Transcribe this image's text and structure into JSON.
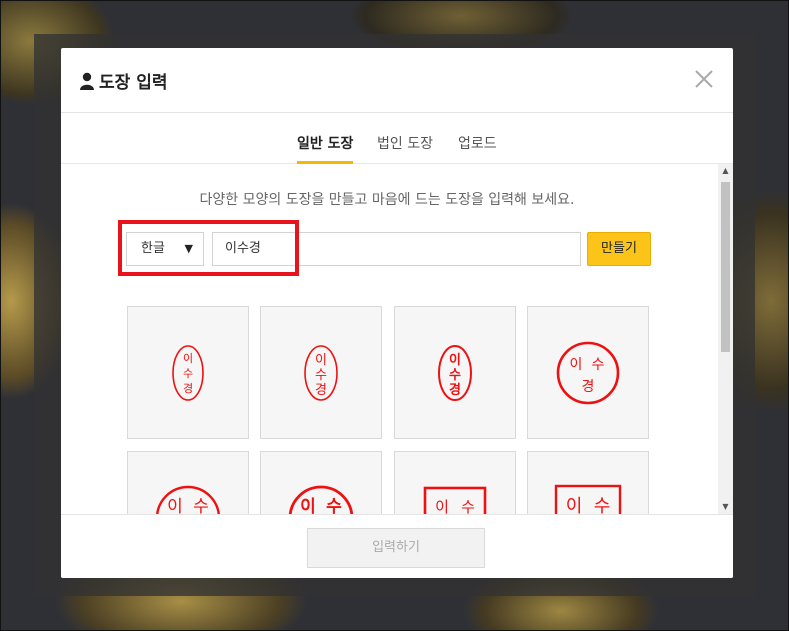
{
  "modal": {
    "title": "도장 입력",
    "close_icon": "close-icon",
    "user_icon": "user-icon"
  },
  "tabs": [
    {
      "label": "일반 도장",
      "active": true
    },
    {
      "label": "법인 도장",
      "active": false
    },
    {
      "label": "업로드",
      "active": false
    }
  ],
  "description": "다양한 모양의 도장을 만들고 마음에 드는 도장을 입력해 보세요.",
  "form": {
    "language_selected": "한글",
    "name_value": "이수경",
    "make_button": "만들기"
  },
  "stamps": {
    "name_chars": [
      "이",
      "수",
      "경"
    ],
    "row1": [
      "oval-seal",
      "oval-plain",
      "oval-bold",
      "circle-seal"
    ],
    "row2": [
      "circle-plain",
      "circle-bold",
      "square-seal",
      "square-plain"
    ]
  },
  "footer": {
    "submit_button": "입력하기"
  },
  "colors": {
    "accent": "#fcc419",
    "stamp_red": "#e11111",
    "highlight_red": "#e8141c"
  }
}
